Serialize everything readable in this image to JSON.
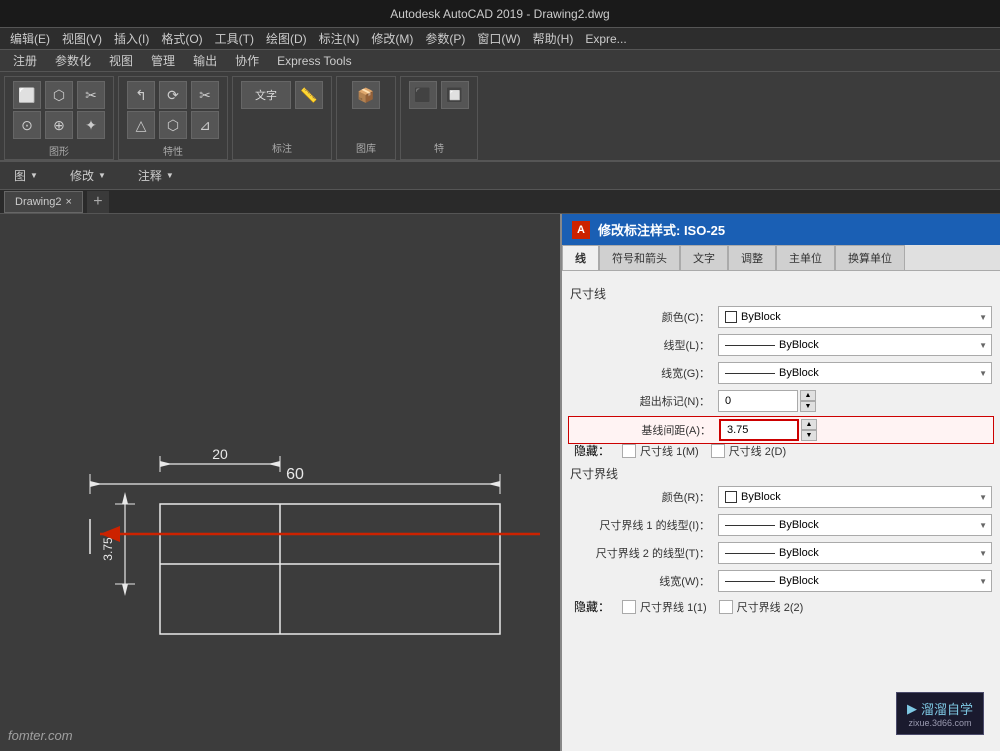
{
  "titleBar": {
    "text": "Autodesk AutoCAD 2019  -  Drawing2.dwg"
  },
  "menuBar": {
    "items": [
      "编辑(E)",
      "视图(V)",
      "插入(I)",
      "格式(O)",
      "工具(T)",
      "绘图(D)",
      "标注(N)",
      "修改(M)",
      "参数(P)",
      "窗口(W)",
      "帮助(H)",
      "Expre..."
    ]
  },
  "ribbonTabs": {
    "items": [
      "注册",
      "参数化",
      "视图",
      "管理",
      "输出",
      "协作",
      "Express Tools"
    ]
  },
  "toolbarRow": {
    "items": [
      "图 ▼",
      "修改 ▼",
      "注释 ▼"
    ]
  },
  "tabs": {
    "close_icon": "×",
    "add_icon": "+",
    "items": [
      "Drawing2"
    ]
  },
  "dialog": {
    "title": "修改标注样式: ISO-25",
    "title_icon": "A",
    "tabs": [
      "线",
      "符号和箭头",
      "文字",
      "调整",
      "主单位",
      "换算单位"
    ],
    "active_tab": "线",
    "sections": {
      "dimension_line": {
        "label": "尺寸线",
        "fields": [
          {
            "label": "颜色(C)：",
            "type": "select",
            "value": "ByBlock",
            "has_icon": true
          },
          {
            "label": "线型(L)：",
            "type": "select",
            "value": "ByBlock",
            "has_line": true
          },
          {
            "label": "线宽(G)：",
            "type": "select",
            "value": "ByBlock",
            "has_line": true
          },
          {
            "label": "超出标记(N)：",
            "type": "number",
            "value": "0",
            "highlighted": false
          },
          {
            "label": "基线间距(A)：",
            "type": "number",
            "value": "3.75",
            "highlighted": true
          }
        ],
        "hide_label": "隐藏：",
        "hide_checkboxes": [
          {
            "label": "尺寸线 1(M)",
            "checked": false
          },
          {
            "label": "尺寸线 2(D)",
            "checked": false
          }
        ]
      },
      "extension_line": {
        "label": "尺寸界线",
        "fields": [
          {
            "label": "颜色(R)：",
            "type": "select",
            "value": "ByBlock",
            "has_icon": true
          },
          {
            "label": "尺寸界线 1 的线型(I)：",
            "type": "select",
            "value": "ByBlock",
            "has_line": true
          },
          {
            "label": "尺寸界线 2 的线型(T)：",
            "type": "select",
            "value": "ByBlock",
            "has_line": true
          },
          {
            "label": "线宽(W)：",
            "type": "select",
            "value": "ByBlock",
            "has_line": true
          }
        ],
        "hide_label": "隐藏：",
        "hide_checkboxes": [
          {
            "label": "尺寸界线 1(1)",
            "checked": false
          },
          {
            "label": "尺寸界线 2(2)",
            "checked": false
          }
        ]
      }
    }
  },
  "drawing": {
    "dimension_60": "60",
    "dimension_20": "20",
    "dimension_375": "3.75",
    "arrow_label": "←"
  },
  "brand": {
    "name": "溜溜自学",
    "url": "zixue.3d66.com",
    "icon": "▶"
  },
  "watermark": {
    "text": "fomter.com"
  }
}
